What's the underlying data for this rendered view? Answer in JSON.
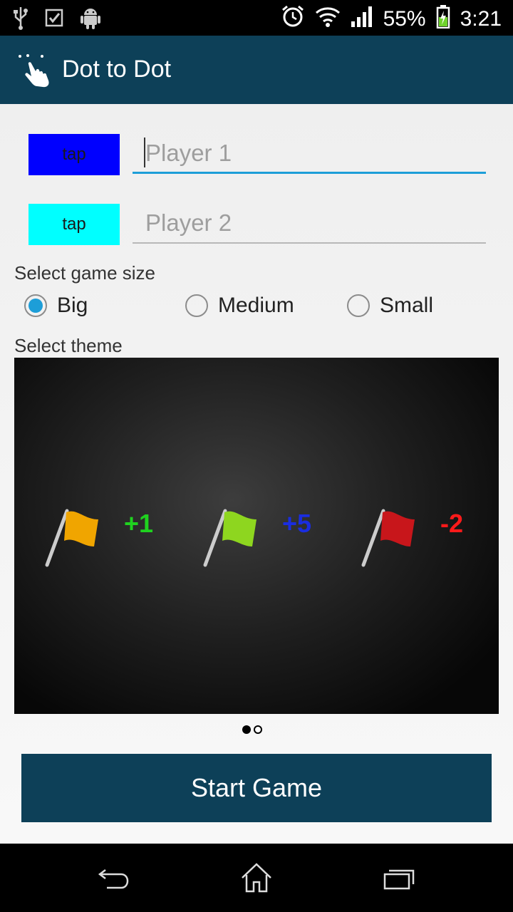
{
  "status_bar": {
    "battery_percent": "55%",
    "time": "3:21",
    "left_icons": [
      "usb-icon",
      "checkbox-icon",
      "android-icon"
    ],
    "right_icons": [
      "alarm-icon",
      "wifi-icon",
      "signal-icon",
      "battery-icon"
    ]
  },
  "action_bar": {
    "title": "Dot to Dot",
    "icon": "touch-hand-icon",
    "color": "#0d4058"
  },
  "players": [
    {
      "color_button_label": "tap",
      "color": "#0000ff",
      "placeholder": "Player 1",
      "value": "",
      "focused": true
    },
    {
      "color_button_label": "tap",
      "color": "#00ffff",
      "placeholder": "Player 2",
      "value": "",
      "focused": false
    }
  ],
  "game_size": {
    "label": "Select game size",
    "options": [
      {
        "label": "Big",
        "selected": true
      },
      {
        "label": "Medium",
        "selected": false
      },
      {
        "label": "Small",
        "selected": false
      }
    ]
  },
  "theme": {
    "label": "Select theme",
    "flags": [
      {
        "icon": "flag-orange-icon",
        "value": "+1",
        "color": "#f0a500",
        "value_color": "#1fd21f"
      },
      {
        "icon": "flag-green-icon",
        "value": "+5",
        "color": "#8ed61f",
        "value_color": "#1a2de0"
      },
      {
        "icon": "flag-red-icon",
        "value": "-2",
        "color": "#c8161b",
        "value_color": "#ff1a1a"
      }
    ],
    "page_indicator": {
      "total": 2,
      "current": 1
    }
  },
  "start_button": {
    "label": "Start Game"
  },
  "nav_bar": {
    "icons": [
      "back-icon",
      "home-icon",
      "recent-apps-icon"
    ]
  }
}
